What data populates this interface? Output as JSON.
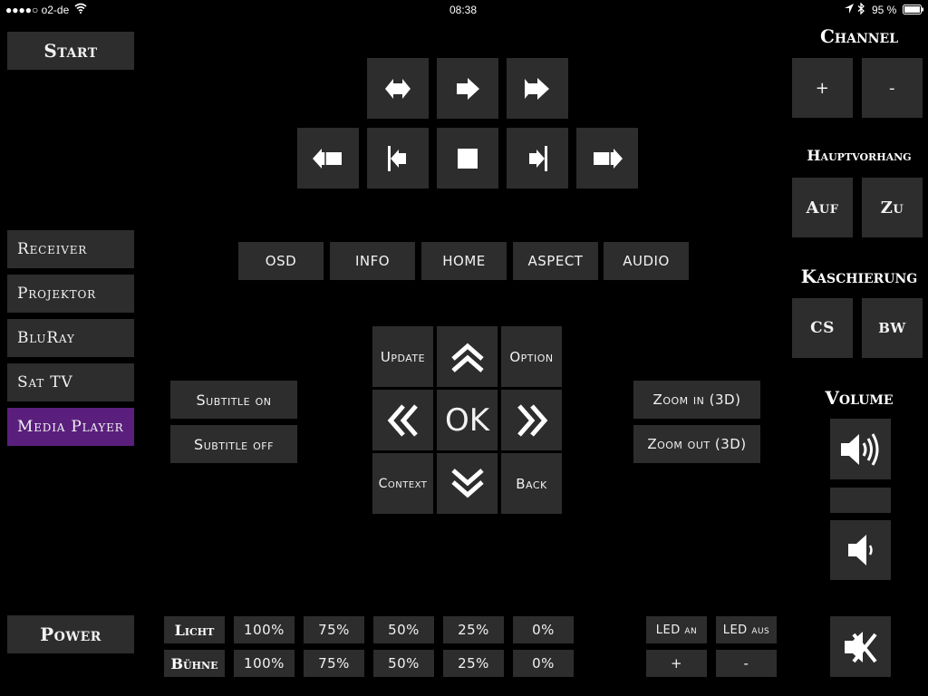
{
  "status_bar": {
    "carrier": "●●●●○ o2-de",
    "time": "08:38",
    "battery": "95 %"
  },
  "left": {
    "start": "Start",
    "sources": [
      "Receiver",
      "Projektor",
      "BluRay",
      "Sat TV",
      "Media Player"
    ],
    "selected": "Media Player",
    "power": "Power"
  },
  "transport": {
    "top_row_icons": [
      "previous-track-icon",
      "play-icon",
      "next-track-icon"
    ],
    "bottom_row_icons": [
      "rewind-icon",
      "step-back-icon",
      "stop-icon",
      "step-forward-icon",
      "fast-forward-icon"
    ]
  },
  "menu_row": [
    "OSD",
    "INFO",
    "HOME",
    "ASPECT",
    "AUDIO"
  ],
  "subtitle": {
    "on": "Subtitle on",
    "off": "Subtitle off"
  },
  "dpad": {
    "update": "Update",
    "option": "Option",
    "ok": "OK",
    "context": "Context",
    "back": "Back"
  },
  "zoom": {
    "in": "Zoom in (3D)",
    "out": "Zoom out (3D)"
  },
  "right": {
    "channel_title": "Channel",
    "channel_plus": "+",
    "channel_minus": "-",
    "curtain_title": "Hauptvorhang",
    "curtain_open": "Auf",
    "curtain_close": "Zu",
    "masking_title": "Kaschierung",
    "masking_cs": "CS",
    "masking_bw": "BW",
    "volume_title": "Volume"
  },
  "light": {
    "licht_label": "Licht",
    "buehne_label": "Bühne",
    "levels": [
      "100%",
      "75%",
      "50%",
      "25%",
      "0%"
    ],
    "led_on": "LED an",
    "led_off": "LED aus",
    "led_plus": "+",
    "led_minus": "-"
  },
  "colors": {
    "background": "#000000",
    "button": "#2d2d2d",
    "selected": "#5a1f7d"
  }
}
